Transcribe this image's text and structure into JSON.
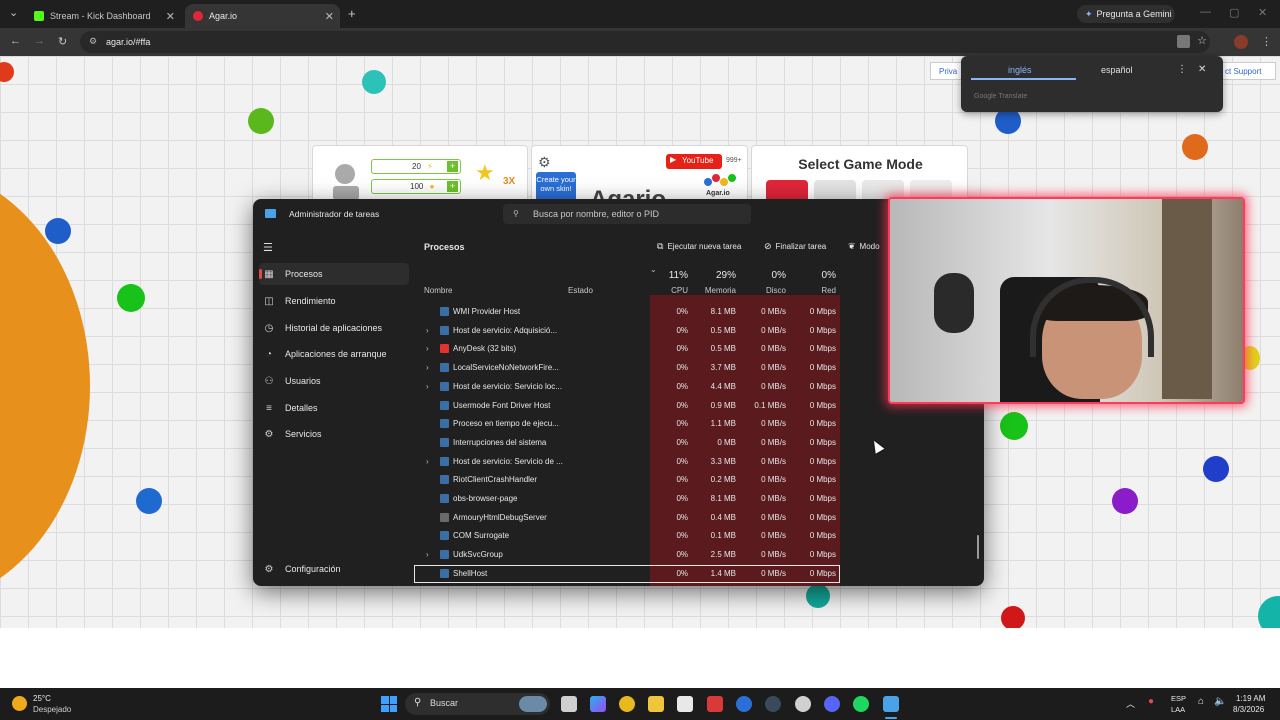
{
  "browser": {
    "tabs": [
      {
        "title": "Stream - Kick Dashboard",
        "favicon_color": "#53fc18"
      },
      {
        "title": "Agar.io",
        "favicon_color": "#e0263a"
      }
    ],
    "new_tab": "+",
    "gemini_label": "Pregunta a Gemini",
    "url": "agar.io/#ffa"
  },
  "translate_popup": {
    "lang_selected": "inglés",
    "lang_other": "español",
    "powered_by": "Google Translate"
  },
  "game": {
    "privacy_link": "Priva",
    "support_link": "ct Support",
    "panel_left": {
      "value1": "20",
      "value2": "100",
      "bonus": "3X"
    },
    "panel_middle": {
      "create_skin": "Create your own skin!",
      "youtube": "YouTube",
      "yt_count": "999+",
      "agar_label": "Agar.io",
      "logo_text": "Agario"
    },
    "panel_right": {
      "title": "Select Game Mode"
    }
  },
  "taskmgr": {
    "title": "Administrador de tareas",
    "search_placeholder": "Busca por nombre, editor o PID",
    "nav": [
      {
        "label": "Procesos",
        "icon": "grid-icon"
      },
      {
        "label": "Rendimiento",
        "icon": "chart-icon"
      },
      {
        "label": "Historial de aplicaciones",
        "icon": "history-icon"
      },
      {
        "label": "Aplicaciones de arranque",
        "icon": "speedometer-icon"
      },
      {
        "label": "Usuarios",
        "icon": "users-icon"
      },
      {
        "label": "Detalles",
        "icon": "list-icon"
      },
      {
        "label": "Servicios",
        "icon": "puzzle-icon"
      }
    ],
    "settings_label": "Configuración",
    "header": "Procesos",
    "run_task": "Ejecutar nueva tarea",
    "end_task": "Finalizar tarea",
    "mode": "Modo",
    "columns": {
      "name": "Nombre",
      "status": "Estado",
      "cpu_pct": "11%",
      "cpu": "CPU",
      "mem_pct": "29%",
      "mem": "Memoria",
      "disk_pct": "0%",
      "disk": "Disco",
      "net_pct": "0%",
      "net": "Red"
    },
    "rows": [
      {
        "name": "WMI Provider Host",
        "expand": "",
        "cpu": "0%",
        "mem": "8.1 MB",
        "disk": "0 MB/s",
        "net": "0 Mbps",
        "color": "#3a6ea5"
      },
      {
        "name": "Host de servicio: Adquisició...",
        "expand": "›",
        "cpu": "0%",
        "mem": "0.5 MB",
        "disk": "0 MB/s",
        "net": "0 Mbps",
        "color": "#3a6ea5"
      },
      {
        "name": "AnyDesk (32 bits)",
        "expand": "›",
        "cpu": "0%",
        "mem": "0.5 MB",
        "disk": "0 MB/s",
        "net": "0 Mbps",
        "color": "#e5322d"
      },
      {
        "name": "LocalServiceNoNetworkFire...",
        "expand": "›",
        "cpu": "0%",
        "mem": "3.7 MB",
        "disk": "0 MB/s",
        "net": "0 Mbps",
        "color": "#3a6ea5"
      },
      {
        "name": "Host de servicio: Servicio loc...",
        "expand": "›",
        "cpu": "0%",
        "mem": "4.4 MB",
        "disk": "0 MB/s",
        "net": "0 Mbps",
        "color": "#3a6ea5"
      },
      {
        "name": "Usermode Font Driver Host",
        "expand": "",
        "cpu": "0%",
        "mem": "0.9 MB",
        "disk": "0.1 MB/s",
        "net": "0 Mbps",
        "color": "#3a6ea5"
      },
      {
        "name": "Proceso en tiempo de ejecu...",
        "expand": "",
        "cpu": "0%",
        "mem": "1.1 MB",
        "disk": "0 MB/s",
        "net": "0 Mbps",
        "color": "#3a6ea5"
      },
      {
        "name": "Interrupciones del sistema",
        "expand": "",
        "cpu": "0%",
        "mem": "0 MB",
        "disk": "0 MB/s",
        "net": "0 Mbps",
        "color": "#3a6ea5"
      },
      {
        "name": "Host de servicio: Servicio de ...",
        "expand": "›",
        "cpu": "0%",
        "mem": "3.3 MB",
        "disk": "0 MB/s",
        "net": "0 Mbps",
        "color": "#3a6ea5"
      },
      {
        "name": "RiotClientCrashHandler",
        "expand": "",
        "cpu": "0%",
        "mem": "0.2 MB",
        "disk": "0 MB/s",
        "net": "0 Mbps",
        "color": "#3a6ea5"
      },
      {
        "name": "obs-browser-page",
        "expand": "",
        "cpu": "0%",
        "mem": "8.1 MB",
        "disk": "0 MB/s",
        "net": "0 Mbps",
        "color": "#3a6ea5"
      },
      {
        "name": "ArmouryHtmlDebugServer",
        "expand": "",
        "cpu": "0%",
        "mem": "0.4 MB",
        "disk": "0 MB/s",
        "net": "0 Mbps",
        "color": "#6a6a6a"
      },
      {
        "name": "COM Surrogate",
        "expand": "",
        "cpu": "0%",
        "mem": "0.1 MB",
        "disk": "0 MB/s",
        "net": "0 Mbps",
        "color": "#3a6ea5"
      },
      {
        "name": "UdkSvcGroup",
        "expand": "›",
        "cpu": "0%",
        "mem": "2.5 MB",
        "disk": "0 MB/s",
        "net": "0 Mbps",
        "color": "#3a6ea5"
      },
      {
        "name": "ShellHost",
        "expand": "",
        "cpu": "0%",
        "mem": "1.4 MB",
        "disk": "0 MB/s",
        "net": "0 Mbps",
        "color": "#3a6ea5"
      }
    ]
  },
  "taskbar": {
    "weather_temp": "25°C",
    "weather_desc": "Despejado",
    "search_label": "Buscar",
    "lang_line1": "ESP",
    "lang_line2": "LAA",
    "time": "1:19 AM",
    "date": "8/3/2026"
  }
}
